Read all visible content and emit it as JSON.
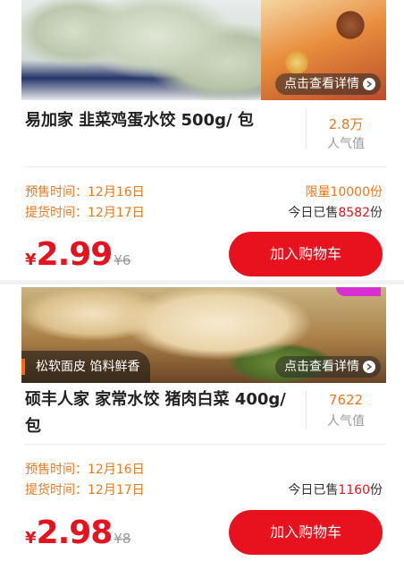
{
  "products": [
    {
      "banner": {
        "view_detail": "点击查看详情",
        "tagline": ""
      },
      "title": "易加家 韭菜鸡蛋水饺 500g/ 包",
      "popularity_value": "2.8万",
      "popularity_label": "人气值",
      "presale": "预售时间：12月16日",
      "pickup": "提货时间：12月17日",
      "limit": "限量10000份",
      "sold_prefix": "今日已售",
      "sold_count": "8582",
      "sold_suffix": "份",
      "currency": "¥",
      "price": "2.99",
      "original_price": "¥6",
      "cart_button": "加入购物车"
    },
    {
      "banner": {
        "view_detail": "点击查看详情",
        "tagline": "松软面皮  馅料鲜香"
      },
      "title_line1": "硕丰人家 家常水饺 猪肉白菜 400g/",
      "title_line2": "包",
      "popularity_value": "7622",
      "popularity_label": "人气值",
      "presale": "预售时间：12月16日",
      "pickup": "提货时间：12月17日",
      "sold_prefix": "今日已售",
      "sold_count": "1160",
      "sold_suffix": "份",
      "currency": "¥",
      "price": "2.98",
      "original_price": "¥8",
      "cart_button": "加入购物车"
    }
  ],
  "colors": {
    "accent_red": "#e8121f",
    "accent_orange": "#e8791f",
    "muted": "#999999"
  },
  "icons": {
    "chevron": "chevron-right-icon"
  }
}
